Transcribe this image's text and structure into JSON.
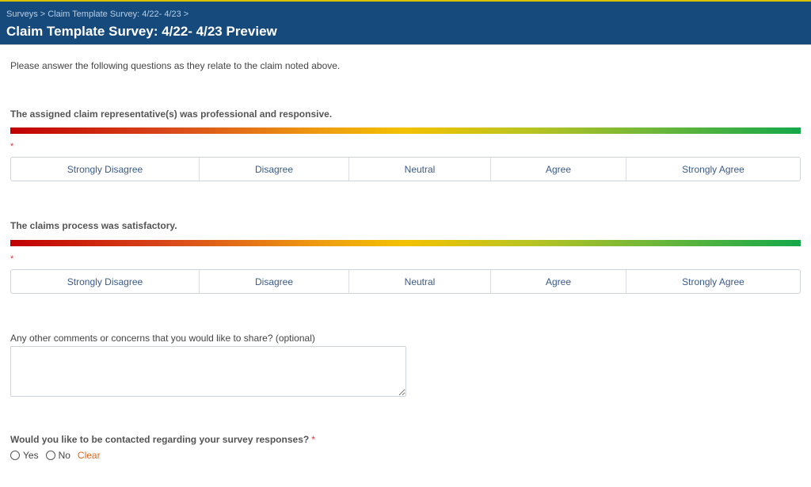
{
  "header": {
    "breadcrumb": [
      "Surveys",
      "Claim Template Survey: 4/22- 4/23"
    ],
    "title": "Claim Template Survey: 4/22- 4/23 Preview"
  },
  "intro": "Please answer the following questions as they relate to the claim noted above.",
  "questions": [
    {
      "label": "The assigned claim representative(s) was professional and responsive.",
      "required_mark": "*",
      "options": [
        "Strongly Disagree",
        "Disagree",
        "Neutral",
        "Agree",
        "Strongly Agree"
      ]
    },
    {
      "label": "The claims process was satisfactory.",
      "required_mark": "*",
      "options": [
        "Strongly Disagree",
        "Disagree",
        "Neutral",
        "Agree",
        "Strongly Agree"
      ]
    }
  ],
  "comments": {
    "label": "Any other comments or concerns that you would like to share? (optional)",
    "value": ""
  },
  "contact": {
    "label": "Would you like to be contacted regarding your survey responses?",
    "required_mark": "*",
    "options": [
      "Yes",
      "No"
    ],
    "clear_label": "Clear"
  },
  "colors": {
    "header_bg": "#174a7c",
    "accent_top": "#d9c200",
    "option_text": "#3a5a8a",
    "required": "#d9363e",
    "clear_link": "#e0651c",
    "scale_start": "#c00000",
    "scale_mid": "#f2c200",
    "scale_end": "#14a84a"
  }
}
